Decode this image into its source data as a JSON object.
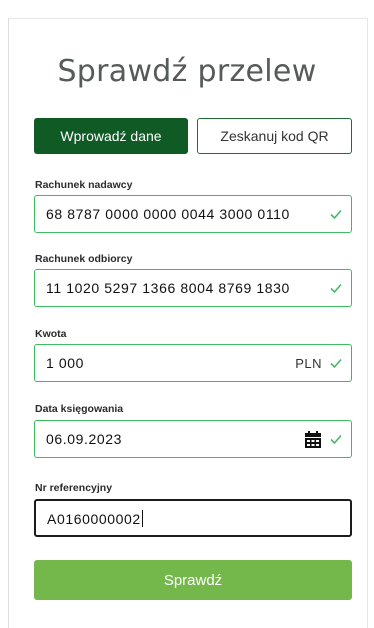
{
  "page": {
    "title": "Sprawdź przelew"
  },
  "tabs": {
    "manual_label": "Wprowadź dane",
    "qr_label": "Zeskanuj kod QR"
  },
  "fields": {
    "sender_account": {
      "label": "Rachunek nadawcy",
      "value": "68 8787 0000 0000 0044 3000 0110",
      "valid": true
    },
    "recipient_account": {
      "label": "Rachunek odbiorcy",
      "value": "11 1020 5297 1366 8004 8769 1830",
      "valid": true
    },
    "amount": {
      "label": "Kwota",
      "value": "1 000",
      "currency": "PLN",
      "valid": true
    },
    "booking_date": {
      "label": "Data księgowania",
      "value": "06.09.2023",
      "icon": "calendar-icon",
      "valid": true
    },
    "reference_number": {
      "label": "Nr referencyjny",
      "value": "A0160000002",
      "focused": true
    }
  },
  "actions": {
    "submit_label": "Sprawdź"
  },
  "colors": {
    "primary_dark_green": "#0f5a25",
    "valid_border_green": "#3dbb61",
    "submit_green": "#74b84c",
    "title_gray": "#555b58"
  }
}
